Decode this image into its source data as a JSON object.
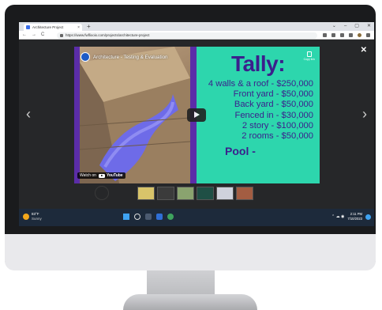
{
  "browser": {
    "tab_title": "Architecture Project",
    "tab_close": "×",
    "new_tab": "+",
    "window_controls": [
      "⌄",
      "–",
      "▢",
      "✕"
    ],
    "nav": {
      "back": "←",
      "forward": "→",
      "reload": "C"
    },
    "url": "https://www.fwflixoix.com/projects/architecture-project"
  },
  "lightbox": {
    "close": "✕",
    "prev": "‹",
    "next": "›"
  },
  "video": {
    "title": "Architecture - Testing & Evaluation",
    "copy_link_label": "Copy link",
    "watch_on": "Watch on",
    "youtube_brand": "YouTube"
  },
  "slide": {
    "heading": "Tally:",
    "lines": [
      "4 walls & a roof - $250,000",
      "Front yard - $50,000",
      "Back yard - $50,000",
      "Fenced in - $30,000",
      "2 story - $100,000",
      "2 rooms - $50,000"
    ],
    "pool": "Pool -"
  },
  "thumbnails": [
    {
      "name": "thumb-1",
      "color": "#d8c46a"
    },
    {
      "name": "thumb-2",
      "color": "#3b3b3b"
    },
    {
      "name": "thumb-3",
      "color": "#8aa36f"
    },
    {
      "name": "thumb-4",
      "color": "#1f4f45"
    },
    {
      "name": "thumb-5",
      "color": "#cfd2dc"
    },
    {
      "name": "thumb-6",
      "color": "#a35d42"
    }
  ],
  "taskbar": {
    "weather_temp": "83°F",
    "weather_cond": "Sunny",
    "tray_icons": "⌃  ☁  ◉",
    "time": "2:11 PM",
    "date": "7/10/2023"
  },
  "colors": {
    "slide_bg": "#2dd6ad",
    "slide_text": "#3b1f8c",
    "accent_bar": "#5b2da8",
    "taskbar": "#1d2a3b"
  }
}
